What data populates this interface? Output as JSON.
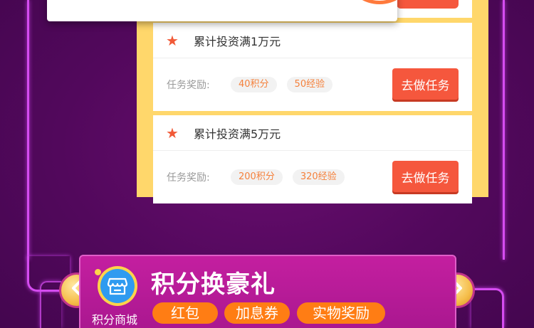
{
  "tasks": [
    {
      "title": "累计投资满1万元",
      "reward_label": "任务奖励:",
      "rewards": [
        "40积分",
        "50经验"
      ],
      "button": "去做任务"
    },
    {
      "title": "累计投资满5万元",
      "reward_label": "任务奖励:",
      "rewards": [
        "200积分",
        "320经验"
      ],
      "button": "去做任务"
    }
  ],
  "banner": {
    "icon": "shop-icon",
    "shop_label": "积分商城",
    "title": "积分换豪礼",
    "tags": [
      "红包",
      "加息券",
      "实物奖励"
    ]
  },
  "icons": {
    "task_marker": "star-icon",
    "prev": "chevron-left-icon",
    "next": "chevron-right-icon"
  },
  "colors": {
    "background": "#54095e",
    "panel": "#ffd76b",
    "accent_button": "#f5573d",
    "star": "#f15a38",
    "pill_text": "#f5813c",
    "banner": "#b81a98",
    "tag": "#ff7d14",
    "shop_icon": "#2f9bf0"
  }
}
